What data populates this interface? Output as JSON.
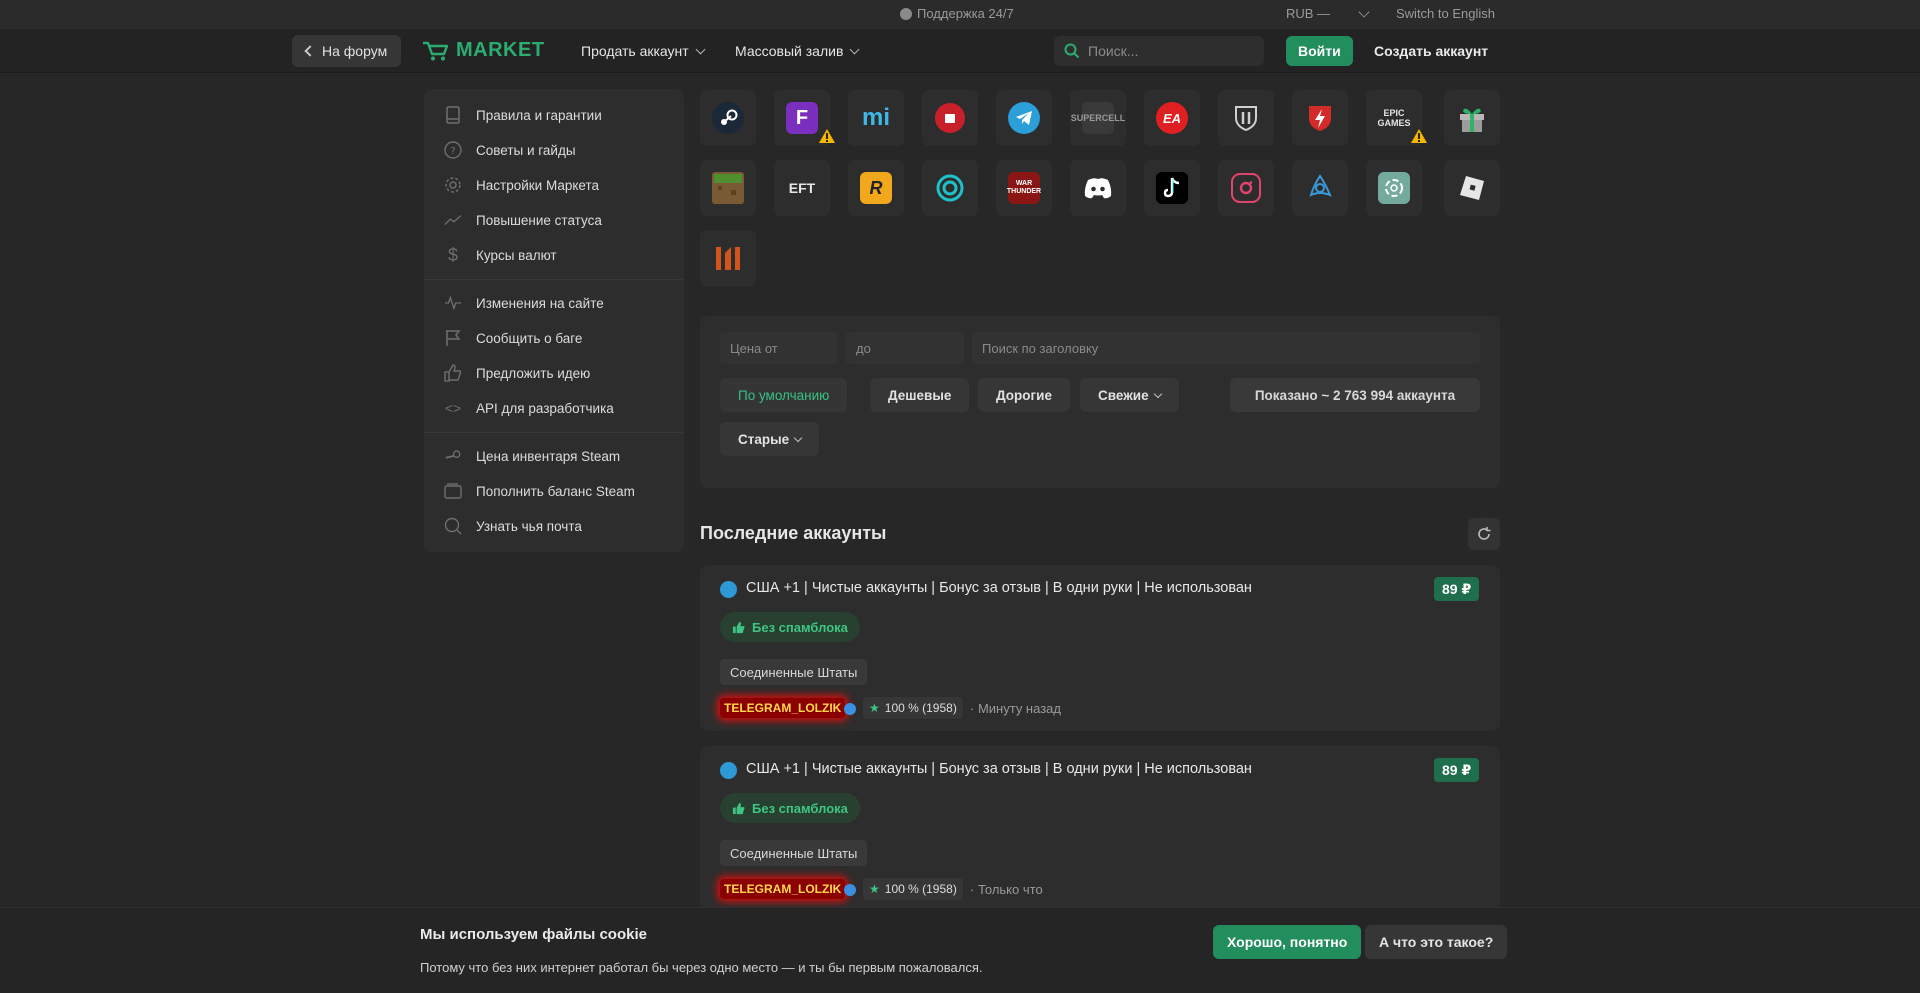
{
  "topbar": {
    "support": "Поддержка 24/7",
    "currency": "RUB —",
    "language": "Switch to English"
  },
  "header": {
    "back": "На форум",
    "logo": "MARKET",
    "nav": [
      "Продать аккаунт",
      "Массовый залив"
    ],
    "search_placeholder": "Поиск...",
    "login": "Войти",
    "signup": "Создать аккаунт"
  },
  "sidebar": {
    "items": [
      "Правила и гарантии",
      "Советы и гайды",
      "Настройки Маркета",
      "Повышение статуса",
      "Курсы валют",
      "Изменения на сайте",
      "Сообщить о баге",
      "Предложить идею",
      "API для разработчика",
      "Цена инвентаря Steam",
      "Пополнить баланс Steam",
      "Узнать чья почта"
    ]
  },
  "filter": {
    "price_from_placeholder": "Цена от",
    "price_to_placeholder": "до",
    "title_search_placeholder": "Поиск по заголовку",
    "sort": [
      "По умолчанию",
      "Дешевые",
      "Дорогие",
      "Свежие",
      "Старые"
    ],
    "shown": "Показано ~ 2 763 994 аккаунта"
  },
  "latest": {
    "title": "Последние аккаунты",
    "cards": [
      {
        "title": "США +1 | Чистые аккаунты | Бонус за отзыв | В одни руки | Не использован",
        "price": "89 ₽",
        "badge": "Без спамблока",
        "country": "Соединенные Штаты",
        "seller": "TELEGRAM_LOLZIK",
        "rating": "100 % (1958)",
        "time": "Минуту назад"
      },
      {
        "title": "США +1 | Чистые аккаунты | Бонус за отзыв | В одни руки | Не использован",
        "price": "89 ₽",
        "badge": "Без спамблока",
        "country": "Соединенные Штаты",
        "seller": "TELEGRAM_LOLZIK",
        "rating": "100 % (1958)",
        "time": "Только что"
      }
    ]
  },
  "cookie": {
    "title": "Мы используем файлы cookie",
    "text": "Потому что без них интернет работал бы через одно место — и ты бы первым пожаловался.",
    "ok": "Хорошо, понятно",
    "what": "А что это такое?"
  },
  "games": {
    "row1": [
      "steam-icon",
      "fortnite-icon",
      "mihoyo-icon",
      "supercell-red-icon",
      "telegram-icon",
      "supercell-icon",
      "ea-icon",
      "world-of-tanks-icon",
      "wot-blitz-icon",
      "epic-games-icon",
      "gift-icon"
    ],
    "row2": [
      "minecraft-icon",
      "escape-from-tarkov-icon",
      "rockstar-icon",
      "ubisoft-icon",
      "war-thunder-icon",
      "discord-icon",
      "tiktok-icon",
      "instagram-icon",
      "battlenet-icon",
      "chatgpt-icon",
      "roblox-icon"
    ],
    "row3": [
      "warface-icon"
    ],
    "labels": {
      "supercell": "SUPERCELL",
      "epic": "EPIC GAMES",
      "eft": "EFT",
      "war_thunder": "WAR THUNDER"
    }
  },
  "colors": {
    "accent": "#228e5d",
    "accent_text": "#37c184",
    "background": "#272727",
    "panel": "#2d2d2d"
  }
}
